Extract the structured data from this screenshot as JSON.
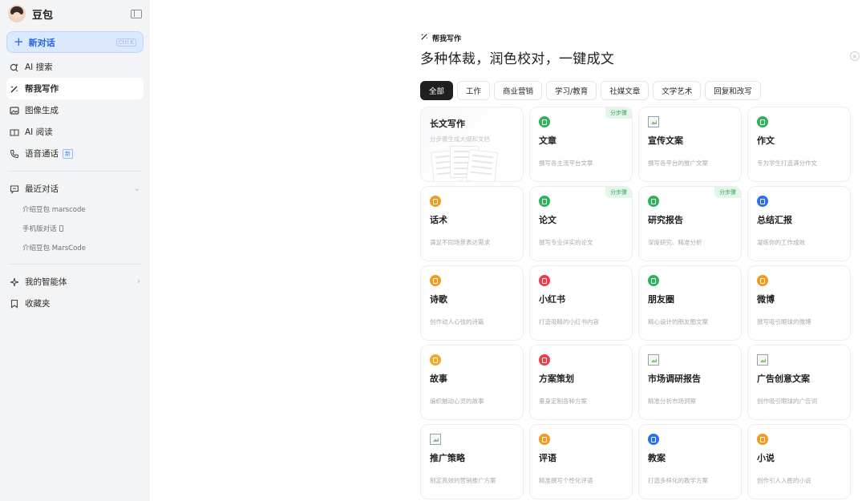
{
  "sidebar": {
    "brand": "豆包",
    "new_chat": {
      "label": "新对话",
      "shortcut": "Ctrl K"
    },
    "nav": [
      {
        "label": "AI 搜索",
        "icon": "search-spark-icon"
      },
      {
        "label": "帮我写作",
        "icon": "write-wand-icon",
        "active": true
      },
      {
        "label": "图像生成",
        "icon": "image-icon"
      },
      {
        "label": "AI 阅读",
        "icon": "book-icon"
      },
      {
        "label": "语音通话",
        "icon": "phone-icon",
        "badge": "新"
      }
    ],
    "recent": {
      "label": "最近对话",
      "items": [
        "介绍豆包 marscode",
        "手机版对话",
        "介绍豆包 MarsCode"
      ]
    },
    "agents_label": "我的智能体",
    "favorites_label": "收藏夹"
  },
  "main": {
    "eyebrow": "帮我写作",
    "headline": "多种体裁，润色校对，一键成文",
    "tabs": [
      "全部",
      "工作",
      "商业营销",
      "学习/教育",
      "社媒文章",
      "文学艺术",
      "回复和改写"
    ],
    "active_tab": "全部",
    "cards": [
      {
        "title": "长文写作",
        "desc": "分步骤生成大纲和文档",
        "kind": "long"
      },
      {
        "title": "文章",
        "desc": "撰写各主流平台文章",
        "icon_color": "#2fb35a",
        "step": "分步骤"
      },
      {
        "title": "宣传文案",
        "desc": "撰写各平台的推广文案",
        "icon": "broken-image"
      },
      {
        "title": "作文",
        "desc": "专为学生打造满分作文",
        "icon_color": "#2fb35a"
      },
      {
        "title": "话术",
        "desc": "满足不同场景表达需求",
        "icon_color": "#f29a1f"
      },
      {
        "title": "论文",
        "desc": "撰写专业详实的论文",
        "icon_color": "#2fb35a",
        "step": "分步骤"
      },
      {
        "title": "研究报告",
        "desc": "深度研究、精准分析",
        "icon_color": "#2fb35a",
        "step": "分步骤"
      },
      {
        "title": "总结汇报",
        "desc": "凝练你的工作成效",
        "icon_color": "#2a6ff0"
      },
      {
        "title": "诗歌",
        "desc": "创作动人心弦的诗篇",
        "icon_color": "#f29a1f"
      },
      {
        "title": "小红书",
        "desc": "打造吸睛的小红书内容",
        "icon_color": "#ef3b4a"
      },
      {
        "title": "朋友圈",
        "desc": "精心设计的朋友圈文案",
        "icon_color": "#2fb35a"
      },
      {
        "title": "微博",
        "desc": "撰写吸引眼球的微博",
        "icon_color": "#f29a1f"
      },
      {
        "title": "故事",
        "desc": "编织触动心灵的故事",
        "icon_color": "#f5a623"
      },
      {
        "title": "方案策划",
        "desc": "量身定制各种方案",
        "icon_color": "#ef3b4a"
      },
      {
        "title": "市场调研报告",
        "desc": "精准分析市场洞察",
        "icon": "broken-image"
      },
      {
        "title": "广告创意文案",
        "desc": "创作吸引眼球的广告词",
        "icon": "broken-image"
      },
      {
        "title": "推广策略",
        "desc": "制定高效的营销推广方案",
        "icon": "broken-image"
      },
      {
        "title": "评语",
        "desc": "精准撰写个性化评语",
        "icon_color": "#f29a1f"
      },
      {
        "title": "教案",
        "desc": "打造多样化的教学方案",
        "icon_color": "#2a6ff0"
      },
      {
        "title": "小说",
        "desc": "创作引人入胜的小说",
        "icon_color": "#f29a1f"
      }
    ]
  }
}
